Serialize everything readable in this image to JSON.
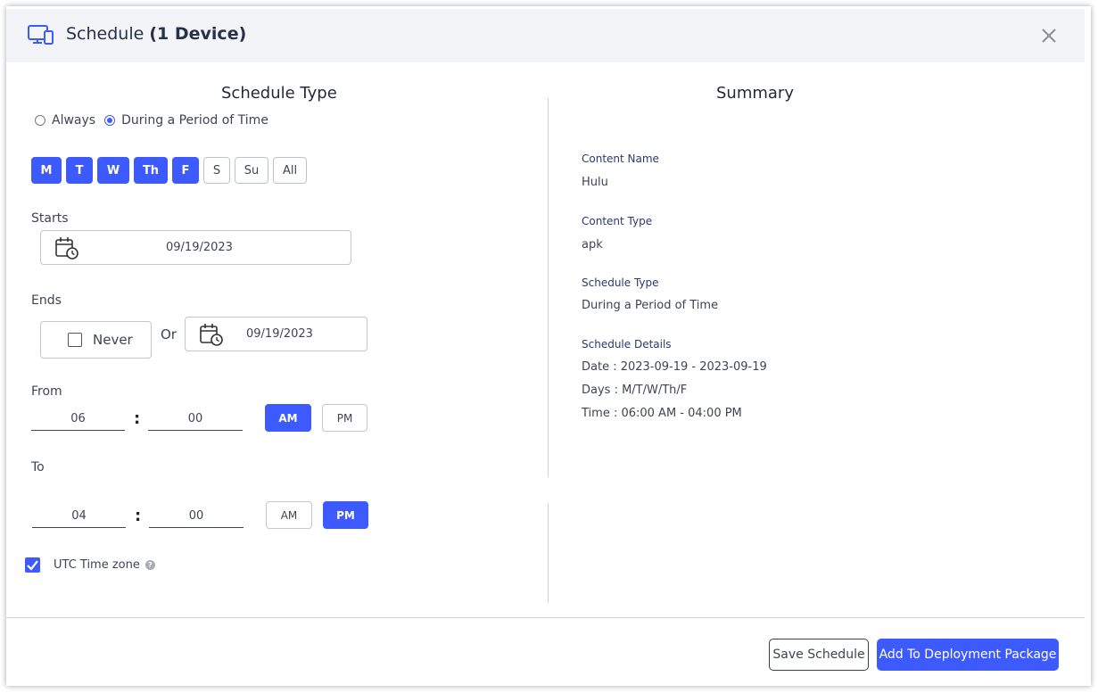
{
  "header": {
    "title_prefix": "Schedule",
    "title_device": "(1 Device)",
    "close_icon": "close-icon",
    "device_icon": "monitor-phone-icon"
  },
  "schedule_type": {
    "heading": "Schedule Type",
    "options": [
      {
        "label": "Always",
        "selected": false
      },
      {
        "label": "During a Period of Time",
        "selected": true
      }
    ],
    "days": [
      {
        "label": "M",
        "selected": true
      },
      {
        "label": "T",
        "selected": true
      },
      {
        "label": "W",
        "selected": true
      },
      {
        "label": "Th",
        "selected": true
      },
      {
        "label": "F",
        "selected": true
      },
      {
        "label": "S",
        "selected": false
      },
      {
        "label": "Su",
        "selected": false
      },
      {
        "label": "All",
        "selected": false
      }
    ],
    "starts": {
      "label": "Starts",
      "date": "09/19/2023"
    },
    "ends": {
      "label": "Ends",
      "never_label": "Never",
      "or_label": "Or",
      "date": "09/19/2023"
    },
    "from": {
      "label": "From",
      "hour": "06",
      "minute": "00",
      "separator": ":",
      "am_label": "AM",
      "pm_label": "PM",
      "period": "AM"
    },
    "to": {
      "label": "To",
      "hour": "04",
      "minute": "00",
      "separator": ":",
      "am_label": "AM",
      "pm_label": "PM",
      "period": "PM"
    },
    "utc": {
      "label": "UTC Time zone",
      "checked": true,
      "help": "?"
    }
  },
  "summary": {
    "heading": "Summary",
    "content_name_label": "Content Name",
    "content_name": "Hulu",
    "content_type_label": "Content Type",
    "content_type": "apk",
    "schedule_type_label": "Schedule Type",
    "schedule_type": "During a Period of Time",
    "details_label": "Schedule Details",
    "date_line": "Date : 2023-09-19 - 2023-09-19",
    "days_line": "Days : M/T/W/Th/F",
    "time_line": "Time : 06:00 AM - 04:00 PM"
  },
  "footer": {
    "save_label": "Save Schedule",
    "add_label": "Add To Deployment Package"
  },
  "colors": {
    "accent": "#3d5afe",
    "header_bg": "#f2f4f8"
  }
}
